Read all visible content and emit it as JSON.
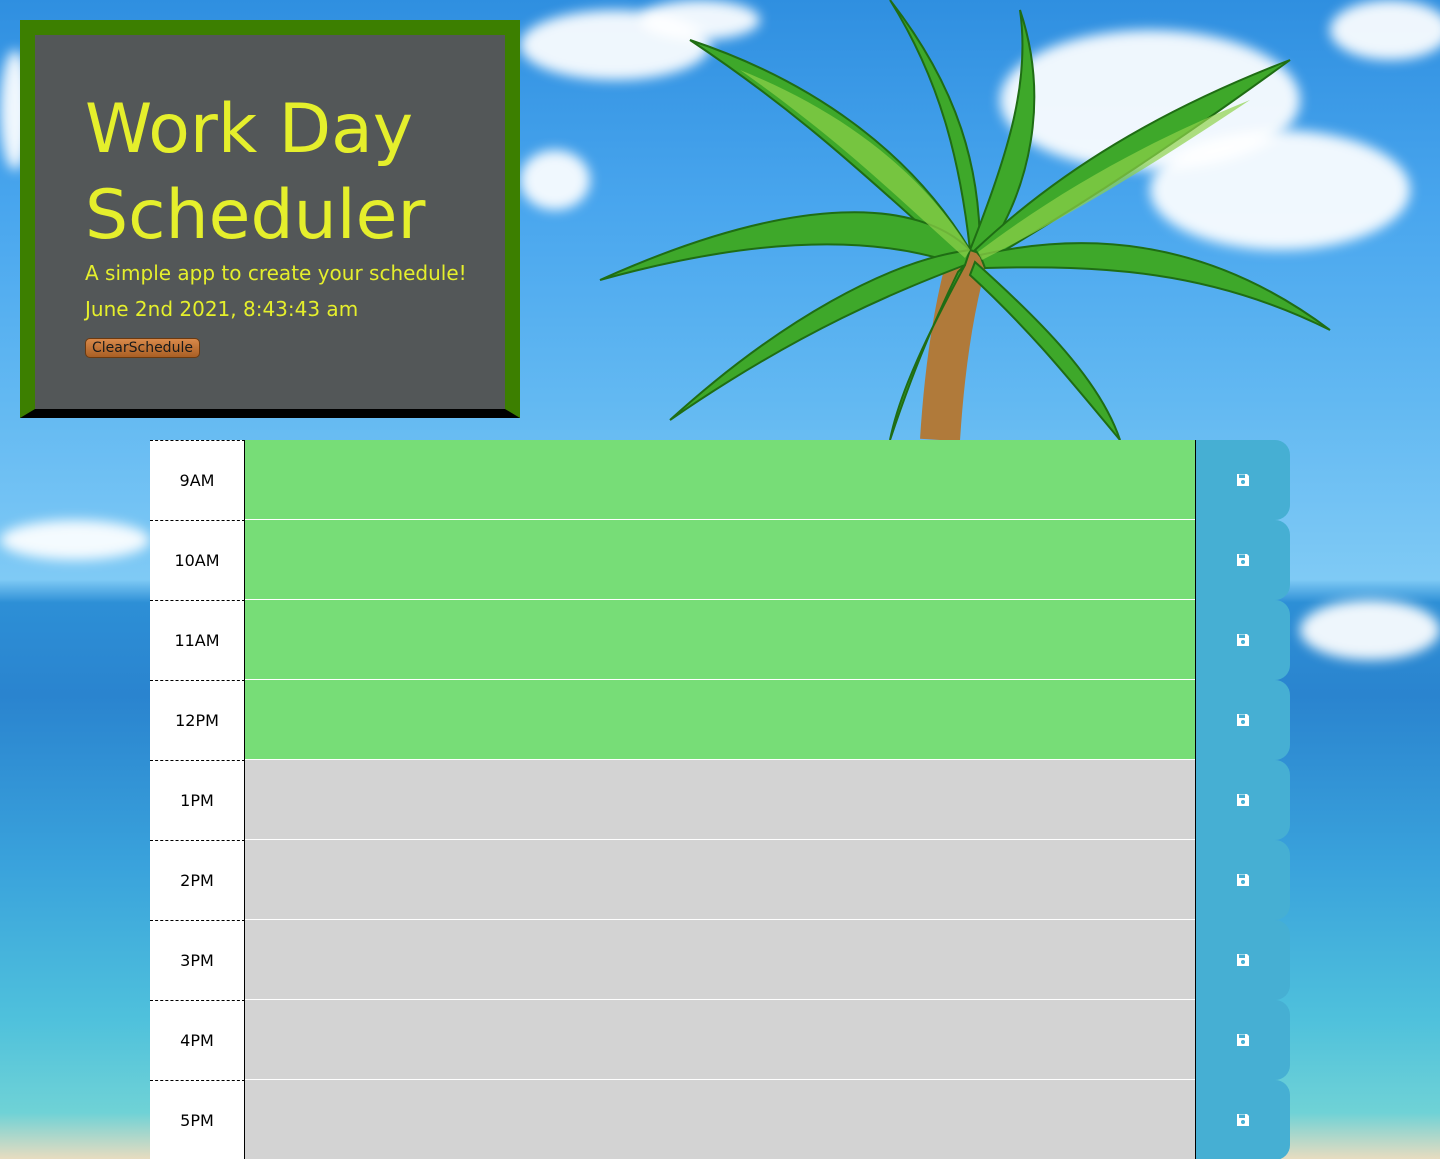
{
  "header": {
    "title": "Work Day Scheduler",
    "subtitle": "A simple app to create your schedule!",
    "datetime": "June 2nd 2021, 8:43:43 am",
    "clear_button_label": "ClearSchedule"
  },
  "schedule": {
    "rows": [
      {
        "hour": "9AM",
        "text": "",
        "state": "present-or-future"
      },
      {
        "hour": "10AM",
        "text": "",
        "state": "present-or-future"
      },
      {
        "hour": "11AM",
        "text": "",
        "state": "present-or-future"
      },
      {
        "hour": "12PM",
        "text": "",
        "state": "present-or-future"
      },
      {
        "hour": "1PM",
        "text": "",
        "state": "past"
      },
      {
        "hour": "2PM",
        "text": "",
        "state": "past"
      },
      {
        "hour": "3PM",
        "text": "",
        "state": "past"
      },
      {
        "hour": "4PM",
        "text": "",
        "state": "past"
      },
      {
        "hour": "5PM",
        "text": "",
        "state": "past"
      }
    ],
    "save_icon": "floppy-disk-icon"
  },
  "colors": {
    "header_background": "#535758",
    "header_border": "#3c7f00",
    "title_text": "#e5ef2c",
    "row_active": "#77dd77",
    "row_past": "#d3d3d3",
    "save_button": "#46afd3"
  }
}
